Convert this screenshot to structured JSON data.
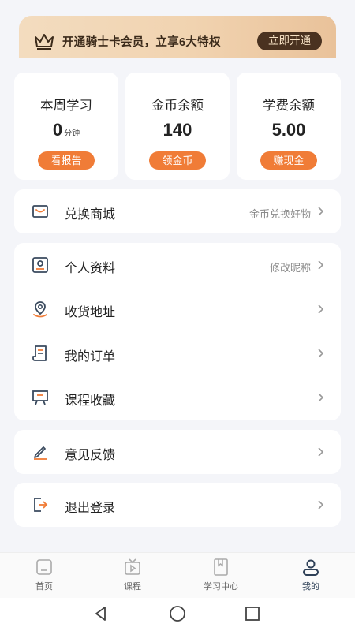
{
  "vip": {
    "text": "开通骑士卡会员，立享6大特权",
    "button": "立即开通"
  },
  "stats": [
    {
      "title": "本周学习",
      "value": "0",
      "unit": "分钟",
      "button": "看报告"
    },
    {
      "title": "金币余额",
      "value": "140",
      "unit": "",
      "button": "领金币"
    },
    {
      "title": "学费余额",
      "value": "5.00",
      "unit": "",
      "button": "赚现金"
    }
  ],
  "shop": {
    "label": "兑换商城",
    "hint": "金币兑换好物"
  },
  "menu": [
    {
      "label": "个人资料",
      "hint": "修改昵称",
      "icon": "profile-icon"
    },
    {
      "label": "收货地址",
      "hint": "",
      "icon": "location-icon"
    },
    {
      "label": "我的订单",
      "hint": "",
      "icon": "order-icon"
    },
    {
      "label": "课程收藏",
      "hint": "",
      "icon": "bookmark-icon"
    }
  ],
  "feedback": {
    "label": "意见反馈"
  },
  "logout": {
    "label": "退出登录"
  },
  "tabs": [
    {
      "label": "首页",
      "icon": "home-icon"
    },
    {
      "label": "课程",
      "icon": "tv-icon"
    },
    {
      "label": "学习中心",
      "icon": "book-icon"
    },
    {
      "label": "我的",
      "icon": "user-icon"
    }
  ],
  "colors": {
    "accent": "#f07c37",
    "vip_dark": "#4a3220",
    "active_tab": "#2e4057"
  }
}
